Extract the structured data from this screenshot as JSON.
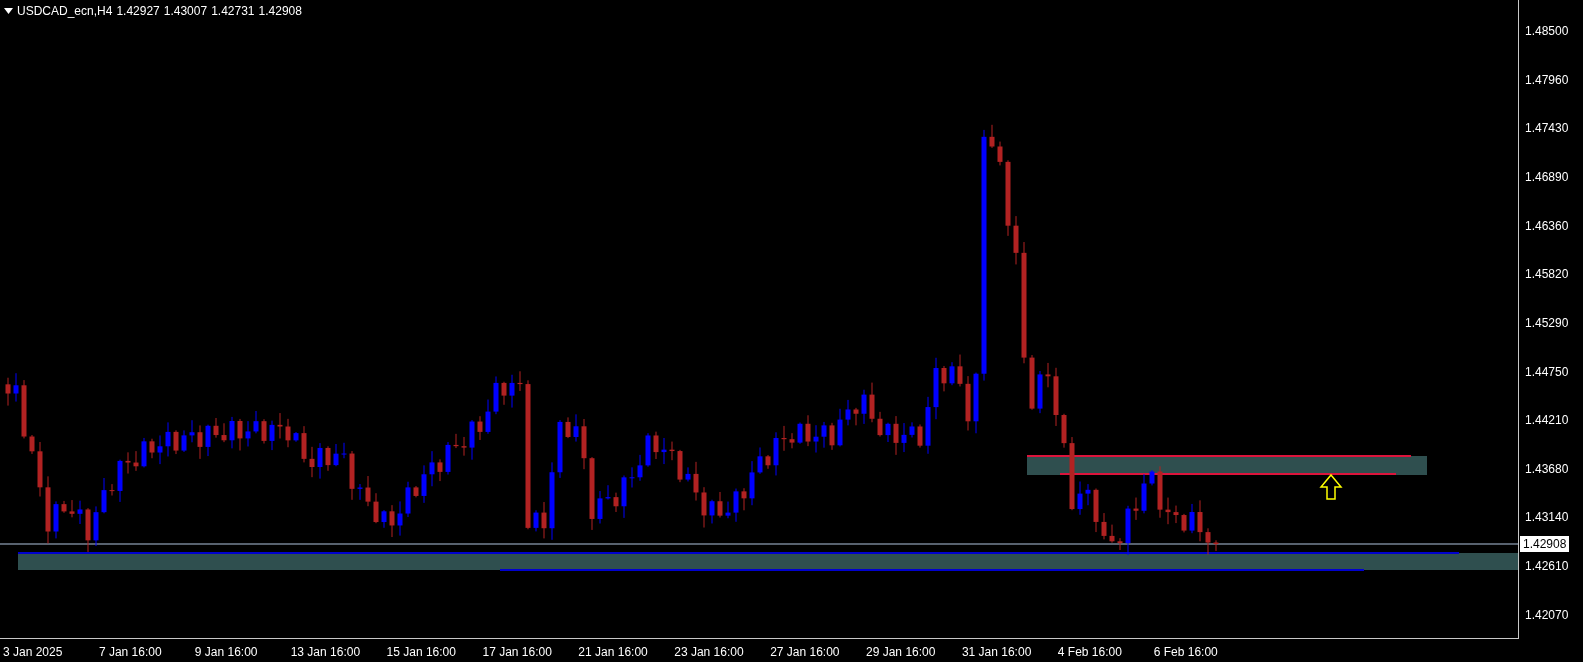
{
  "header": {
    "symbol": "USDCAD_ecn,H4",
    "quotes": [
      "1.42927",
      "1.43007",
      "1.42731",
      "1.42908"
    ]
  },
  "price_axis": {
    "ticks": [
      "1.48500",
      "1.47960",
      "1.47430",
      "1.46890",
      "1.46360",
      "1.45820",
      "1.45290",
      "1.44750",
      "1.44210",
      "1.43680",
      "1.43140",
      "1.42610",
      "1.42070"
    ],
    "current_price": "1.42908"
  },
  "time_axis": {
    "labels": [
      "3 Jan 2025",
      "7 Jan 16:00",
      "9 Jan 16:00",
      "13 Jan 16:00",
      "15 Jan 16:00",
      "17 Jan 16:00",
      "21 Jan 16:00",
      "23 Jan 16:00",
      "27 Jan 16:00",
      "29 Jan 16:00",
      "31 Jan 16:00",
      "4 Feb 16:00",
      "6 Feb 16:00"
    ]
  }
}
